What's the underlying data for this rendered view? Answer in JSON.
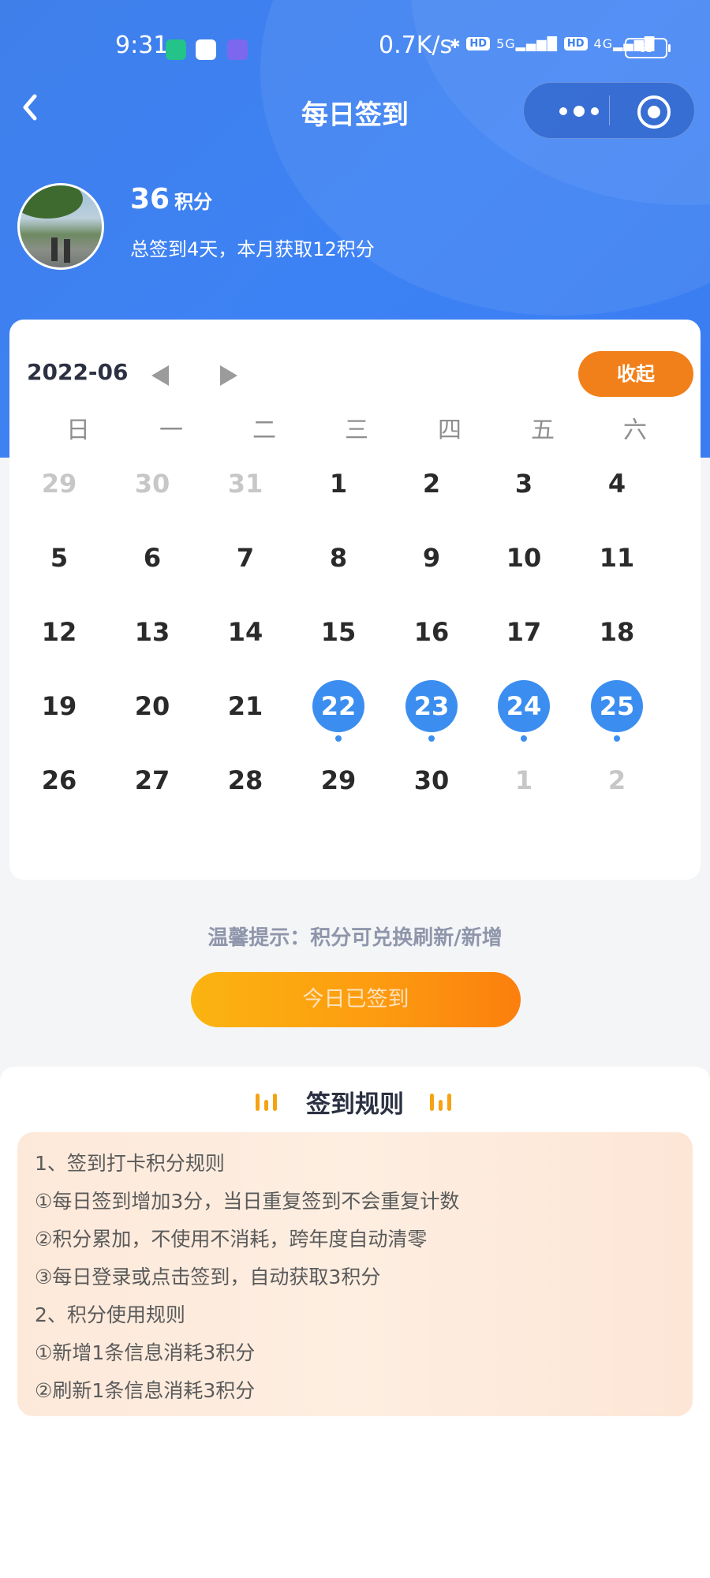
{
  "status_bar": {
    "time": "9:31",
    "net_speed": "0.7K/s",
    "signal_labels": [
      "HD",
      "5G",
      "HD",
      "4G"
    ],
    "battery": "63"
  },
  "navbar": {
    "back_icon": "chevron-left-icon",
    "title": "每日签到",
    "more_icon": "more-dots-icon",
    "close_icon": "target-circle-icon"
  },
  "user": {
    "points": "36",
    "points_unit": "积分",
    "summary": "总签到4天，本月获取12积分"
  },
  "calendar": {
    "month": "2022-06",
    "collapse_label": "收起",
    "weekdays": [
      "日",
      "一",
      "二",
      "三",
      "四",
      "五",
      "六"
    ],
    "weeks": [
      [
        {
          "d": "29",
          "other": true
        },
        {
          "d": "30",
          "other": true
        },
        {
          "d": "31",
          "other": true
        },
        {
          "d": "1"
        },
        {
          "d": "2"
        },
        {
          "d": "3"
        },
        {
          "d": "4"
        }
      ],
      [
        {
          "d": "5"
        },
        {
          "d": "6"
        },
        {
          "d": "7"
        },
        {
          "d": "8"
        },
        {
          "d": "9"
        },
        {
          "d": "10"
        },
        {
          "d": "11"
        }
      ],
      [
        {
          "d": "12"
        },
        {
          "d": "13"
        },
        {
          "d": "14"
        },
        {
          "d": "15"
        },
        {
          "d": "16"
        },
        {
          "d": "17"
        },
        {
          "d": "18"
        }
      ],
      [
        {
          "d": "19"
        },
        {
          "d": "20"
        },
        {
          "d": "21"
        },
        {
          "d": "22",
          "signed": true
        },
        {
          "d": "23",
          "signed": true
        },
        {
          "d": "24",
          "signed": true
        },
        {
          "d": "25",
          "signed": true
        }
      ],
      [
        {
          "d": "26"
        },
        {
          "d": "27"
        },
        {
          "d": "28"
        },
        {
          "d": "29"
        },
        {
          "d": "30"
        },
        {
          "d": "1",
          "other": true
        },
        {
          "d": "2",
          "other": true
        }
      ]
    ],
    "signed_color": "#3b8ef0"
  },
  "tip": "温馨提示：积分可兑换刷新/新增",
  "sign_button": "今日已签到",
  "rules": {
    "title": "签到规则",
    "lines": [
      "1、签到打卡积分规则",
      "①每日签到增加3分，当日重复签到不会重复计数",
      "②积分累加，不使用不消耗，跨年度自动清零",
      "③每日登录或点击签到，自动获取3积分",
      "2、积分使用规则",
      "①新增1条信息消耗3积分",
      "②刷新1条信息消耗3积分"
    ]
  },
  "colors": {
    "primary_blue": "#3d82f5",
    "accent_orange": "#f1801a",
    "rules_bg": "#fde9da"
  }
}
